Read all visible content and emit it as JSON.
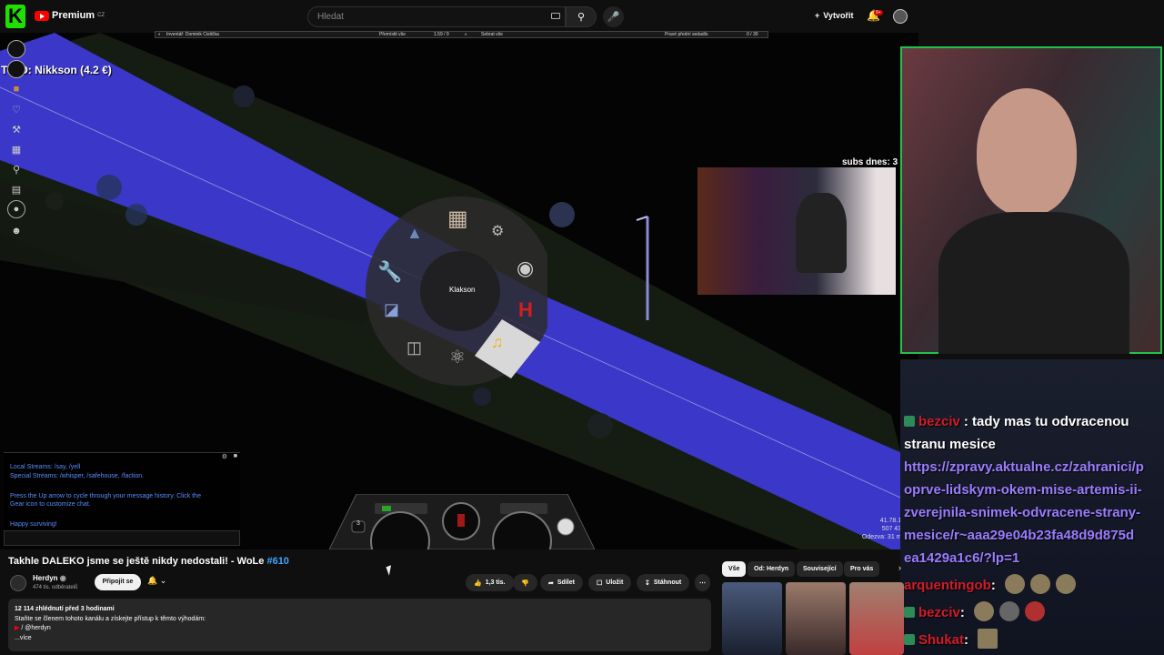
{
  "header": {
    "premium_label": "Premium",
    "region": "CZ",
    "search_placeholder": "Hledat",
    "create_label": "Vytvořit",
    "notif_count": "9+"
  },
  "game": {
    "top_donor": "TopD: Nikkson (4.2 €)",
    "inventory_bar": {
      "left_label": "Inventář: Dominik Cistička",
      "move_all": "Přemístit vše",
      "weight_left": "1.59 / 9",
      "collect_all": "Sebrat vše",
      "right_label": "Pravé přední sedadlo",
      "weight_right": "0 / 30"
    },
    "radial_menu": {
      "center_label": "Klakson"
    },
    "chat": {
      "lines": [
        "Local Streams: /say, /yell",
        "Special Streams: /whisper, /safehouse, /faction.",
        "Press the Up arrow to cycle through your message history. Click the",
        "Gear icon to customize chat.",
        "Happy surviving!"
      ]
    },
    "coords": [
      "41.78.18",
      "507 436",
      "Odezva: 31 ms"
    ],
    "gear_number": "3"
  },
  "stream": {
    "subs_today": "subs dnes: 3"
  },
  "overlay_chat": {
    "messages": [
      {
        "user": "bezciv",
        "text": ": tady mas tu odvracenou stranu mesice"
      },
      {
        "link": "https://zpravy.aktualne.cz/zahranici/popve-lidskym-okem-mise-artemis-ii-zverejnila-snimek-odvracene-strany-mesice/r~aaa29e04b23fa48d9d875dea1429a1c6/?lp=1"
      },
      {
        "user": "arquentingob",
        "text": ":"
      },
      {
        "user": "bezciv",
        "text": ":"
      },
      {
        "user": "Shukat",
        "text": ":"
      }
    ],
    "link_lines": [
      "https://zpravy.aktualne.cz/zahranici/p",
      "oprve-lidskym-okem-mise-artemis-ii-",
      "zverejnila-snimek-odvracene-strany-",
      "mesice/r~aaa29e04b23fa48d9d875d",
      "ea1429a1c6/?lp=1"
    ],
    "first_line_1": ": tady mas tu odvracenou",
    "first_line_2": "stranu mesice"
  },
  "video": {
    "title": "Takhle DALEKO jsme se ještě nikdy nedostali! - WoLe",
    "hashtag": "#610",
    "channel_name": "Herdyn",
    "channel_subs": "474 tis. odběratelů",
    "join_label": "Připojit se",
    "like_count": "1,3 tis.",
    "share_label": "Sdílet",
    "save_label": "Uložit",
    "download_label": "Stáhnout",
    "views_line": "12 114 zhlédnutí  před 3 hodinami",
    "desc_line1": "Staňte se členem tohoto kanálu a získejte přístup k těmto výhodám:",
    "desc_line2": "/ @herdyn",
    "more_label": "...více"
  },
  "chips": [
    "Vše",
    "Od: Herdyn",
    "Související",
    "Pro vás"
  ],
  "colors": {
    "kick_green": "#1fe000",
    "yt_red": "#ff0000",
    "road_blue": "#3b37c8",
    "cam_border": "#21c24c",
    "chat_user_red": "#d21c28",
    "chat_link": "#9b7cff"
  }
}
